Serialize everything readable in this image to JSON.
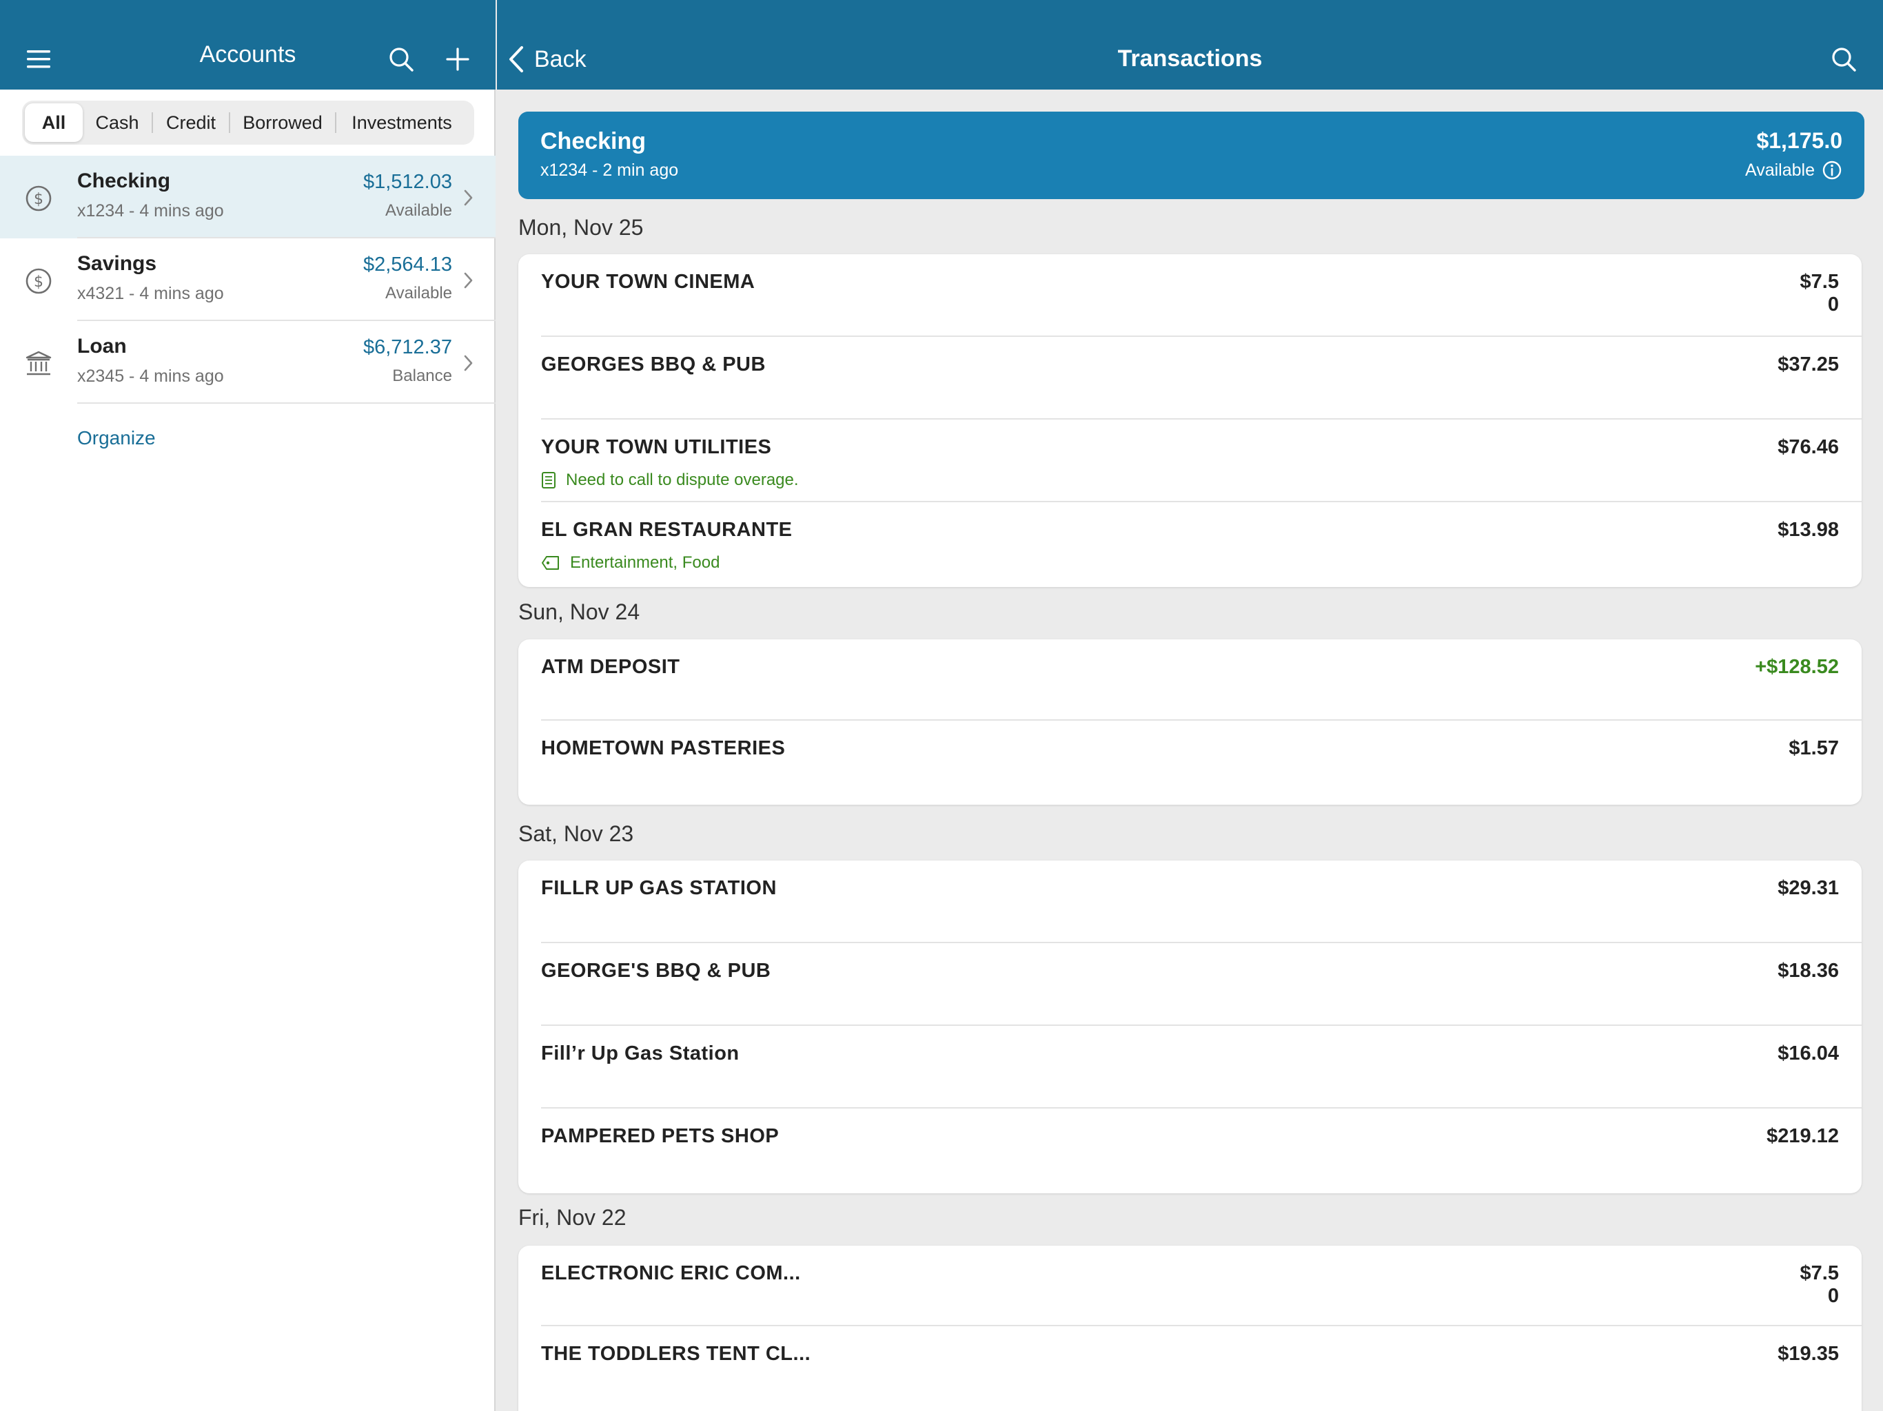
{
  "accounts_pane": {
    "title": "Accounts",
    "filters": [
      "All",
      "Cash",
      "Credit",
      "Borrowed",
      "Investments"
    ],
    "selected_filter": "All",
    "accounts": [
      {
        "name": "Checking",
        "sub": "x1234 - 4 mins ago",
        "amount": "$1,512.03",
        "label": "Available",
        "icon": "dollar-circle-icon"
      },
      {
        "name": "Savings",
        "sub": "x4321 - 4 mins ago",
        "amount": "$2,564.13",
        "label": "Available",
        "icon": "dollar-circle-icon"
      },
      {
        "name": "Loan",
        "sub": "x2345 - 4 mins ago",
        "amount": "$6,712.37",
        "label": "Balance",
        "icon": "bank-icon"
      }
    ],
    "organize_label": "Organize"
  },
  "transactions_pane": {
    "title": "Transactions",
    "back_label": "Back",
    "account": {
      "name": "Checking",
      "sub": "x1234 - 2 min ago",
      "amount": "$1,175.0",
      "label": "Available"
    },
    "days": [
      {
        "date": "Mon, Nov 25",
        "items": [
          {
            "name": "YOUR TOWN CINEMA",
            "amount": "$7.50"
          },
          {
            "name": "GEORGES BBQ & PUB",
            "amount": "$37.25"
          },
          {
            "name": "YOUR TOWN UTILITIES",
            "amount": "$76.46",
            "note": "Need to call to dispute overage."
          },
          {
            "name": "EL GRAN RESTAURANTE",
            "amount": "$13.98",
            "tags": "Entertainment, Food"
          }
        ]
      },
      {
        "date": "Sun, Nov 24",
        "items": [
          {
            "name": "ATM DEPOSIT",
            "amount": "+$128.52"
          },
          {
            "name": "HOMETOWN PASTERIES",
            "amount": "$1.57"
          }
        ]
      },
      {
        "date": "Sat, Nov 23",
        "items": [
          {
            "name": "FILLR UP GAS STATION",
            "amount": "$29.31"
          },
          {
            "name": "GEORGE'S BBQ & PUB",
            "amount": "$18.36"
          },
          {
            "name": "Fill’r Up Gas Station",
            "amount": "$16.04"
          },
          {
            "name": "PAMPERED PETS SHOP",
            "amount": "$219.12"
          }
        ]
      },
      {
        "date": "Fri, Nov 22",
        "items": [
          {
            "name": "ELECTRONIC ERIC COM...",
            "amount": "$7.50"
          },
          {
            "name": "THE TODDLERS TENT CL...",
            "amount": "$19.35"
          }
        ]
      }
    ]
  },
  "colors": {
    "brand": "#196e97",
    "banner": "#1a80b3",
    "positive": "#3a8a1f",
    "background": "#ebebeb"
  }
}
